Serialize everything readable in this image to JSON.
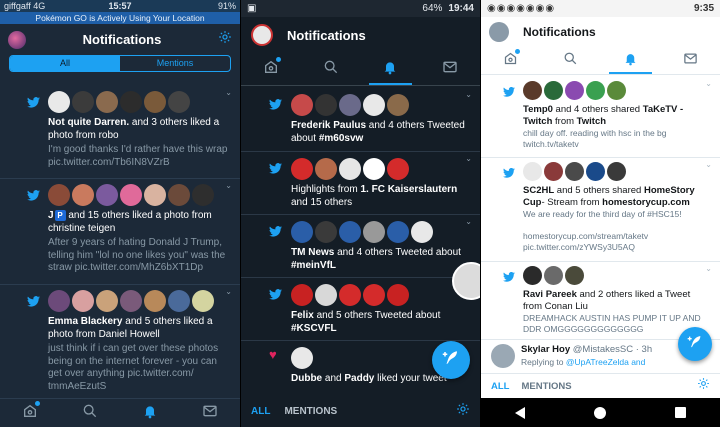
{
  "colors": {
    "twitter_blue": "#1da1f2",
    "dark_bg": "#1c2938",
    "darker_bg": "#141d26",
    "light_bg": "#ffffff"
  },
  "phone1": {
    "status": {
      "carrier": "giffgaff  4G",
      "time": "15:57",
      "battery": "91%"
    },
    "banner": "Pokémon GO is Actively Using Your Location",
    "header_title": "Notifications",
    "segments": {
      "all": "All",
      "mentions": "Mentions"
    },
    "items": [
      {
        "avatars": [
          "#e9e9e9",
          "#3b3b3b",
          "#8a6a4e",
          "#2c2c2c",
          "#7a5a3a",
          "#444"
        ],
        "user": "Not quite Darren.",
        "text": " and 3 others liked a photo from robo",
        "sub": "I'm good thanks I'd rather have this wrap pic.twitter.com/Tb6IN8VZrB"
      },
      {
        "avatars": [
          "#8a4b38",
          "#c97a5e",
          "#7b5a9e",
          "#e06a9a",
          "#d9b3a0",
          "#6b4a3a",
          "#2e2e2e",
          "#a77d5a"
        ],
        "user": "J",
        "badge": "P",
        "text": " and 15 others liked a photo from christine teigen",
        "sub": "After 9 years of hating Donald J Trump, telling him \"lol no one likes you\" was the straw pic.twitter.com/MhZ6bXT1Dp"
      },
      {
        "avatars": [
          "#6c4a7a",
          "#d8a0a0",
          "#caa27a",
          "#7a5a7a",
          "#b8895a",
          "#4a6a9a",
          "#d4d4a0"
        ],
        "user": "Emma Blackery",
        "text": " and 5 others liked a photo from Daniel Howell",
        "sub": "just think if i can get over these photos being on the internet forever - you can get over anything pic.twitter.com/ tmmAeEzutS"
      }
    ]
  },
  "phone2": {
    "status": {
      "battery": "64%",
      "time": "19:44"
    },
    "header_title": "Notifications",
    "items": [
      {
        "avatars": [
          "#c64a4a",
          "#333",
          "#6a6a8a",
          "#e8e8e8",
          "#8a6a4a"
        ],
        "user": "Frederik Paulus",
        "text": " and 4 others Tweeted about ",
        "tag": "#m60svw"
      },
      {
        "avatars": [
          "#d42b2b",
          "#b56a4a",
          "#e6e6e6",
          "#ffffff",
          "#d42b2b"
        ],
        "pre": "Highlights from ",
        "user": "1. FC Kaiserslautern",
        "text": " and 15 others"
      },
      {
        "avatars": [
          "#2a5ea8",
          "#3a3a3a",
          "#2a5ea8",
          "#999",
          "#2a5ea8",
          "#e8e8e8"
        ],
        "user": "TM News",
        "text": " and 4 others Tweeted about ",
        "tag": "#meinVfL"
      },
      {
        "avatars": [
          "#c82222",
          "#d8d8d8",
          "#d42b2b",
          "#d42b2b",
          "#c82222"
        ],
        "user": "Felix",
        "text": " and 5 others Tweeted about ",
        "tag": "#KSCVFL"
      },
      {
        "avatars": [
          "#e8e8e8"
        ],
        "user": "Dubbe",
        "text": " and ",
        "user2": "Paddy",
        "text2": " liked your tweet"
      }
    ],
    "tabs": {
      "all": "ALL",
      "mentions": "MENTIONS"
    }
  },
  "phone3": {
    "status": {
      "time": "9:35"
    },
    "header_title": "Notifications",
    "items": [
      {
        "avatars": [
          "#5a3a2a",
          "#2a6a3a",
          "#8a4ab0",
          "#3aa050",
          "#5a8a3a"
        ],
        "user": "Temp0",
        "text": " and 4 others shared ",
        "user2": "TaKeTV - Twitch",
        "text2": " from ",
        "user3": "Twitch",
        "sub": "chill day off. reading with hsc in the bg twitch.tv/taketv"
      },
      {
        "avatars": [
          "#e8e8e8",
          "#8a3a3a",
          "#4a4a4a",
          "#1a4a8a",
          "#3a3a3a"
        ],
        "user": "SC2HL",
        "text": " and 5 others shared ",
        "user2": "HomeStory Cup",
        "text2": "- Stream from ",
        "user3": "homestorycup.com",
        "sub": "We are ready for the third day of #HSC15!\n\nhomestorycup.com/stream/taketv pic.twitter.com/zYWSy3U5AQ"
      },
      {
        "avatars": [
          "#2a2a2a",
          "#6a6a6a",
          "#4a4a3a"
        ],
        "user": "Ravi Pareek",
        "text": " and 2 others liked a Tweet from Conan Liu",
        "sub": "DREAMHACK AUSTIN HAS PUMP IT UP AND DDR OMGGGGGGGGGGGGG"
      }
    ],
    "reply": {
      "name": "Skylar Hoy",
      "handle": "@MistakesSC · 3h",
      "replying": "Replying to ",
      "mention": "@UpATreeZelda and"
    },
    "tabs": {
      "all": "ALL",
      "mentions": "MENTIONS"
    }
  }
}
